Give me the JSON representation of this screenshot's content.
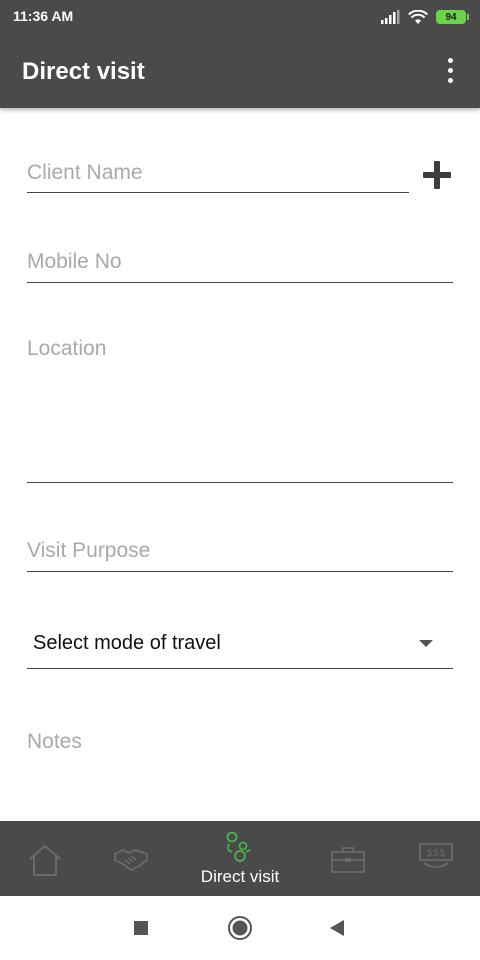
{
  "status_bar": {
    "time": "11:36 AM",
    "battery": "94"
  },
  "app_bar": {
    "title": "Direct visit"
  },
  "form": {
    "client_name_placeholder": "Client Name",
    "mobile_placeholder": "Mobile No",
    "location_placeholder": "Location",
    "visit_purpose_placeholder": "Visit Purpose",
    "travel_mode_selected": "Select mode of travel",
    "notes_placeholder": "Notes"
  },
  "bottom_nav": {
    "items": [
      {
        "id": "home",
        "icon": "home-icon",
        "label": ""
      },
      {
        "id": "handshake",
        "icon": "handshake-icon",
        "label": ""
      },
      {
        "id": "direct-visit",
        "icon": "direct-visit-icon",
        "label": "Direct visit",
        "active": true
      },
      {
        "id": "briefcase",
        "icon": "briefcase-icon",
        "label": ""
      },
      {
        "id": "money",
        "icon": "money-icon",
        "label": ""
      }
    ]
  },
  "colors": {
    "header_bg": "#4a4a4a",
    "active_icon": "#4caf50",
    "inactive_icon": "#6a6a6a",
    "battery": "#6bd34a",
    "placeholder": "#a9a9a9"
  }
}
